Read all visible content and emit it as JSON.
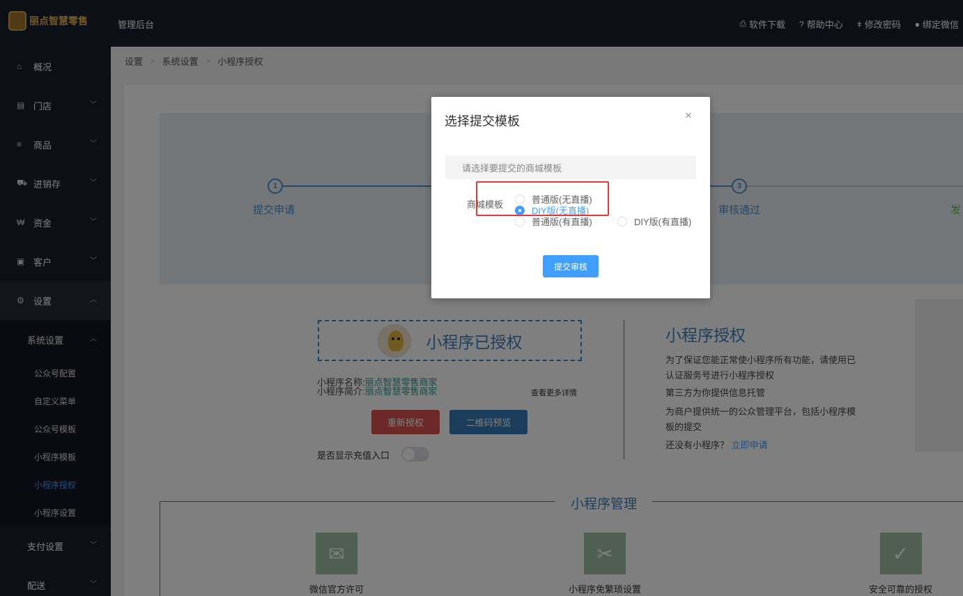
{
  "header": {
    "logo_text": "丽点智慧零售",
    "admin_title": "管理后台",
    "links": [
      {
        "icon": "download-icon",
        "glyph": "⎙",
        "label": "软件下载"
      },
      {
        "icon": "help-icon",
        "glyph": "❓",
        "label": "帮助中心"
      },
      {
        "icon": "thermometer-icon",
        "glyph": "🌡",
        "label": "修改密码"
      },
      {
        "icon": "wechat-icon",
        "glyph": "💬",
        "label": "绑定微信"
      }
    ]
  },
  "sidebar": {
    "items": [
      {
        "label": "概况",
        "glyph": "⌂"
      },
      {
        "label": "门店",
        "glyph": "▤"
      },
      {
        "label": "商品",
        "glyph": "≡"
      },
      {
        "label": "进销存",
        "glyph": "⛟"
      },
      {
        "label": "资金",
        "glyph": "₩"
      },
      {
        "label": "客户",
        "glyph": "▣"
      },
      {
        "label": "设置",
        "glyph": "⚙"
      }
    ],
    "subgroup_title": "系统设置",
    "sub_items": [
      "公众号配置",
      "自定义菜单",
      "公众号模板",
      "小程序模板",
      "小程序授权",
      "小程序设置"
    ],
    "bottom_items": [
      "支付设置",
      "配送"
    ]
  },
  "breadcrumb": [
    "设置",
    "系统设置",
    "小程序授权"
  ],
  "steps": {
    "step1": {
      "num": "1",
      "label": "提交申请"
    },
    "step3": {
      "num": "3",
      "label": "审核通过"
    },
    "step4_label": "发"
  },
  "auth": {
    "title": "小程序已授权",
    "name_label": "小程序名称:",
    "name_value": "丽点智慧零售商家",
    "intro_label": "小程序简介:",
    "intro_value": "丽点智慧零售商家",
    "more_link": "查看更多详情",
    "reauth_button": "重新授权",
    "qr_button": "二维码预览",
    "toggle_label": "是否显示充值入口"
  },
  "right_panel": {
    "title": "小程序授权",
    "para1_line1": "为了保证您能正常使小程序所有功能，请使用已",
    "para1_line2": "认证服务号进行小程序授权",
    "para2": "第三方为你提供信息托管",
    "para3_line1": "为商户提供统一的公众管理平台，包括小程序模",
    "para3_line2": "板的提交",
    "para4": "还没有小程序？",
    "apply_link": "立即申请"
  },
  "management": {
    "title": "小程序管理",
    "features": [
      {
        "label": "微信官方许可",
        "icon": "wechat-icon"
      },
      {
        "label": "小程序免繁琐设置",
        "icon": "tools-icon"
      },
      {
        "label": "安全可靠的授权",
        "icon": "shield-icon"
      }
    ]
  },
  "modal": {
    "title": "选择提交模板",
    "close": "×",
    "hint": "请选择要提交的商城模板",
    "field_label": "商城模板",
    "options": [
      {
        "label": "普通版(无直播)",
        "checked": false
      },
      {
        "label": "DIY版(无直播)",
        "checked": true
      },
      {
        "label": "普通版(有直播)",
        "checked": false
      },
      {
        "label": "DIY版(有直播)",
        "checked": false
      }
    ],
    "submit": "提交审核"
  }
}
